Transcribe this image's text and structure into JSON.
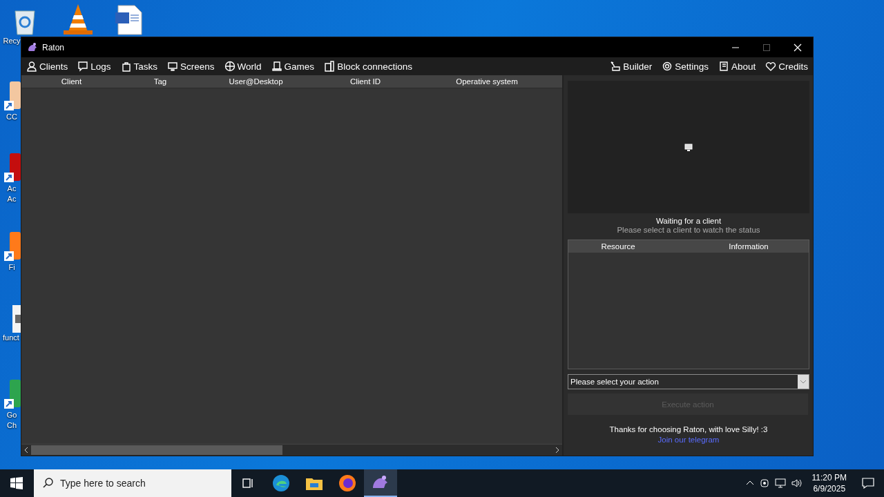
{
  "desktop": {
    "icons": [
      {
        "kind": "recycle",
        "lines": [
          "Recy"
        ]
      },
      {
        "kind": "cone"
      },
      {
        "kind": "document"
      },
      {
        "kind": "shortcut",
        "lines": [
          "CC"
        ]
      },
      {
        "kind": "shortcut-red",
        "lines": [
          "Ac",
          "Ac"
        ]
      },
      {
        "kind": "shortcut-fox",
        "lines": [
          "Fi"
        ]
      },
      {
        "kind": "file",
        "lines": [
          "funct"
        ]
      },
      {
        "kind": "shortcut-chrome",
        "lines": [
          "Go",
          "Ch"
        ]
      }
    ]
  },
  "window": {
    "title": "Raton",
    "toolbar_left": [
      {
        "label": "Clients"
      },
      {
        "label": "Logs"
      },
      {
        "label": "Tasks"
      },
      {
        "label": "Screens"
      },
      {
        "label": "World"
      },
      {
        "label": "Games"
      },
      {
        "label": "Block connections"
      }
    ],
    "toolbar_right": [
      {
        "label": "Builder"
      },
      {
        "label": "Settings"
      },
      {
        "label": "About"
      },
      {
        "label": "Credits"
      }
    ],
    "clients_table": {
      "columns": [
        "Client",
        "Tag",
        "User@Desktop",
        "Client ID",
        "Operative system"
      ]
    },
    "status": {
      "title": "Waiting for a client",
      "subtitle": "Please select a client to watch the status"
    },
    "resource_table": {
      "columns": [
        "Resource",
        "Information"
      ]
    },
    "action_select": {
      "value": "Please select your action"
    },
    "execute_button": {
      "label": "Execute action",
      "disabled": true
    },
    "footer": {
      "message": "Thanks for choosing Raton, with love Silly! :3",
      "link": "Join our telegram"
    }
  },
  "taskbar": {
    "search_placeholder": "Type here to search",
    "apps": [
      {
        "kind": "taskview",
        "selected": false
      },
      {
        "kind": "edge",
        "selected": false
      },
      {
        "kind": "explorer",
        "selected": false
      },
      {
        "kind": "firefox",
        "selected": false
      },
      {
        "kind": "raton",
        "selected": true
      }
    ],
    "clock": {
      "time": "11:20 PM",
      "date": "6/9/2025"
    }
  }
}
